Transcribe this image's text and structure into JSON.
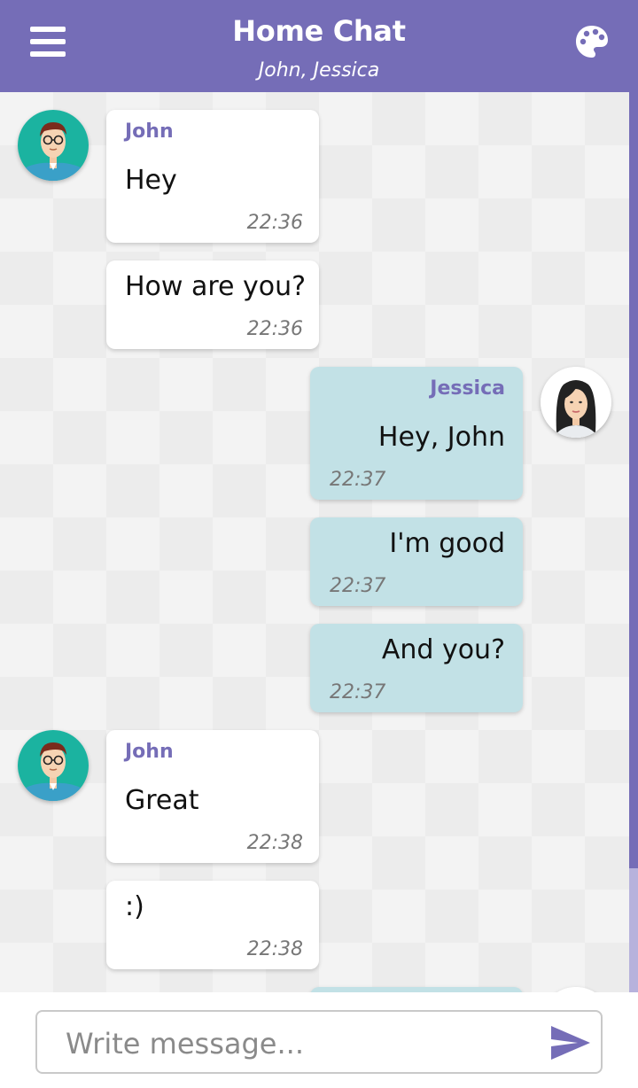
{
  "header": {
    "title": "Home Chat",
    "subtitle": "John, Jessica",
    "menu_icon": "hamburger-menu-icon",
    "theme_icon": "palette-icon"
  },
  "messages": [
    {
      "sender": "John",
      "text": "Hey",
      "time": "22:36",
      "side": "left",
      "show_sender": true
    },
    {
      "sender": "John",
      "text": "How are you?",
      "time": "22:36",
      "side": "left",
      "show_sender": false
    },
    {
      "sender": "Jessica",
      "text": "Hey, John",
      "time": "22:37",
      "side": "right",
      "show_sender": true
    },
    {
      "sender": "Jessica",
      "text": "I'm good",
      "time": "22:37",
      "side": "right",
      "show_sender": false
    },
    {
      "sender": "Jessica",
      "text": "And you?",
      "time": "22:37",
      "side": "right",
      "show_sender": false
    },
    {
      "sender": "John",
      "text": "Great",
      "time": "22:38",
      "side": "left",
      "show_sender": true
    },
    {
      "sender": "John",
      "text": ":)",
      "time": "22:38",
      "side": "left",
      "show_sender": false
    }
  ],
  "composer": {
    "placeholder": "Write message...",
    "value": "",
    "send_icon": "send-icon"
  },
  "colors": {
    "accent": "#756db7",
    "incoming_bubble": "#ffffff",
    "outgoing_bubble": "#c2e1e6"
  }
}
